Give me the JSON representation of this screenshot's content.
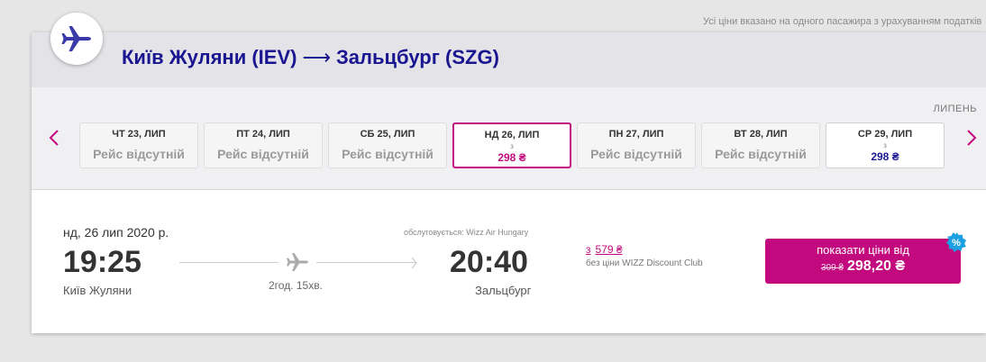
{
  "notice": "Усі ціни вказано на одного пасажира з урахуванням податків",
  "route": {
    "origin": "Київ Жуляни (IEV)",
    "arrow": "⟶",
    "destination": "Зальцбург (SZG)"
  },
  "calendar": {
    "month": "ЛИПЕНЬ",
    "tiles": [
      {
        "label": "ЧТ 23, ЛИП",
        "status": "Рейс відсутній"
      },
      {
        "label": "ПТ 24, ЛИП",
        "status": "Рейс відсутній"
      },
      {
        "label": "СБ 25, ЛИП",
        "status": "Рейс відсутній"
      },
      {
        "label": "НД 26, ЛИП",
        "prefix": "з",
        "price": "298 ₴"
      },
      {
        "label": "ПН 27, ЛИП",
        "status": "Рейс відсутній"
      },
      {
        "label": "ВТ 28, ЛИП",
        "status": "Рейс відсутній"
      },
      {
        "label": "СР 29, ЛИП",
        "prefix": "з",
        "price": "298 ₴"
      }
    ]
  },
  "flight": {
    "date": "нд, 26 лип 2020 р.",
    "operated_by": "обслуговується: Wizz Air Hungary",
    "departure_time": "19:25",
    "departure_city": "Київ Жуляни",
    "arrival_time": "20:40",
    "arrival_city": "Зальцбург",
    "duration": "2год. 15хв."
  },
  "club": {
    "from": "з",
    "price": "579 ₴",
    "note": "без ціни WIZZ Discount Club"
  },
  "price_button": {
    "label": "показати ціни від",
    "old_price": "309 ₴",
    "new_price": "298,20 ₴",
    "badge": "%"
  },
  "colors": {
    "brand_blue": "#1a1591",
    "brand_pink": "#c20a7e",
    "badge_blue": "#1ba0e2"
  },
  "icons": [
    "plane-logo-icon",
    "chevron-left-icon",
    "chevron-right-icon",
    "plane-icon",
    "chevron-small-icon",
    "percent-badge-icon"
  ]
}
